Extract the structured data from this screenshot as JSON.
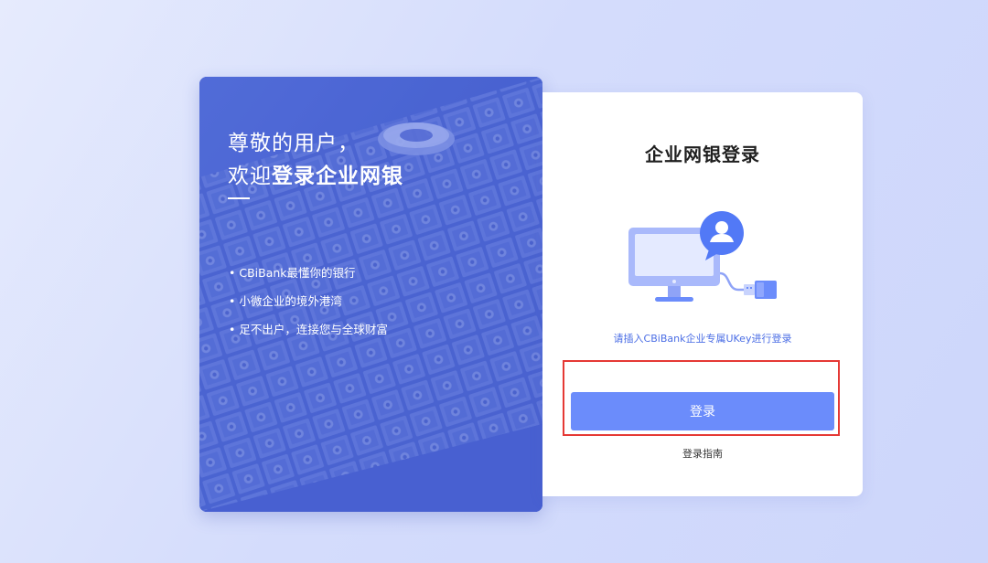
{
  "hero": {
    "greeting_line1": "尊敬的用户，",
    "greeting_prefix": "欢迎",
    "greeting_emphasis": "登录企业网银",
    "bullets": [
      "CBiBank最懂你的银行",
      "小微企业的境外港湾",
      "足不出户，连接您与全球财富"
    ]
  },
  "card": {
    "title": "企业网银登录",
    "ukey_hint": "请插入CBiBank企业专属UKey进行登录",
    "login_label": "登录",
    "guide_label": "登录指南"
  },
  "colors": {
    "primary_button": "#6b8cfb",
    "hint_text": "#4a6de5",
    "hero_background": "#4a63d6",
    "highlight": "#e53935"
  },
  "icons": {
    "illustration": "monitor-ukey-icon",
    "chat_bubble": "user-chat-bubble-icon"
  }
}
